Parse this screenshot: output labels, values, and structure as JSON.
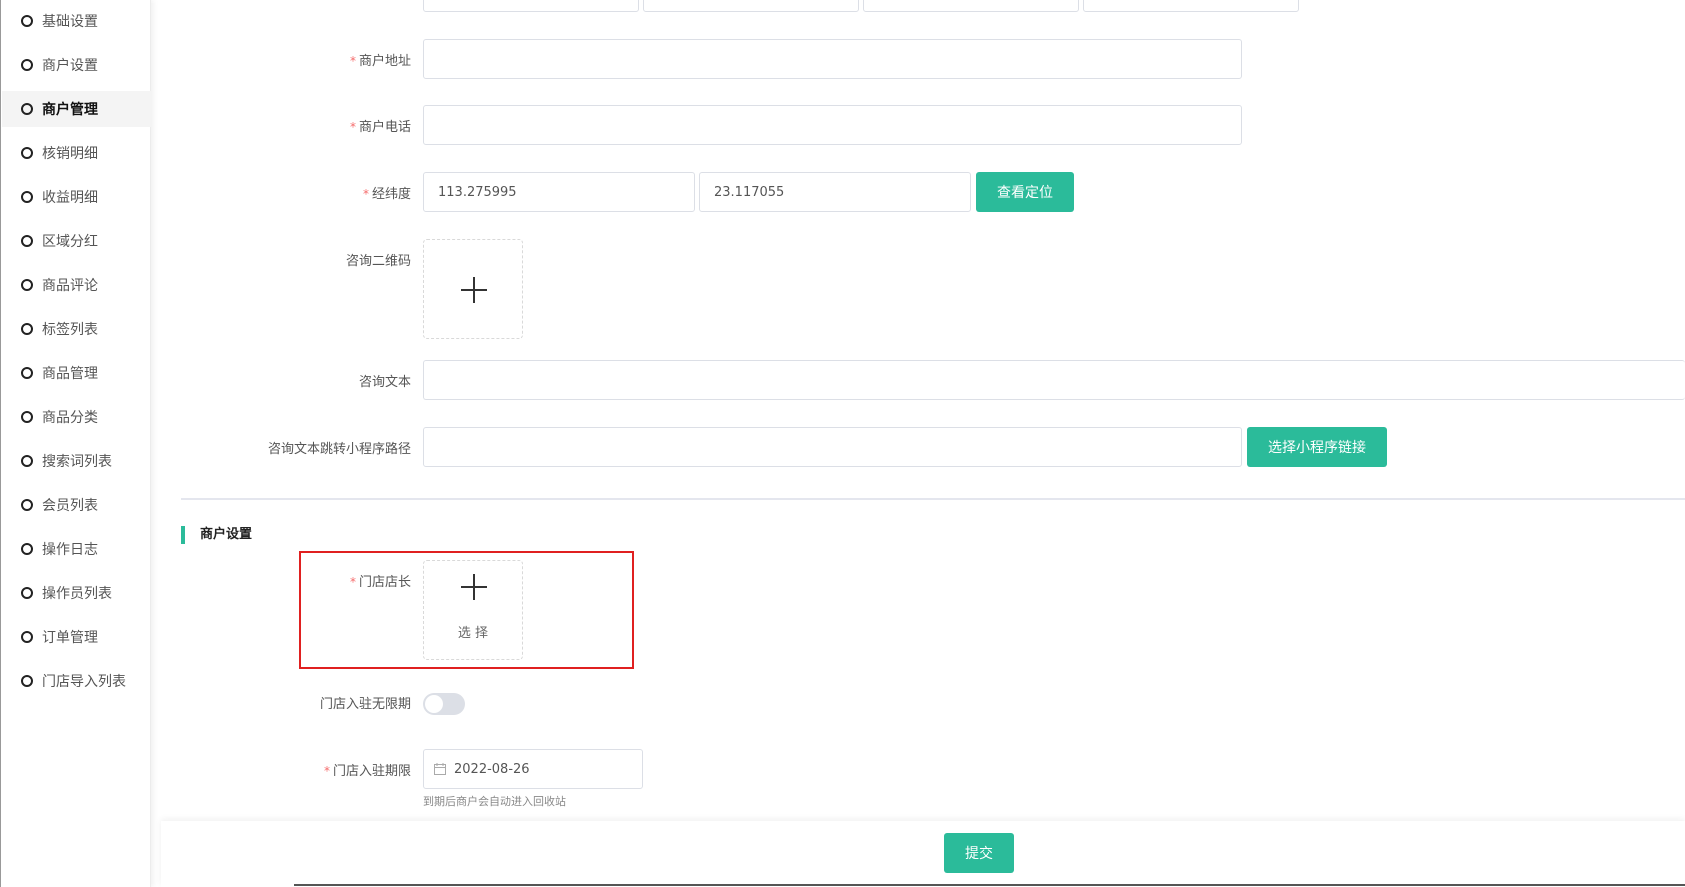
{
  "sidebar": {
    "items": [
      {
        "label": "基础设置",
        "active": false
      },
      {
        "label": "商户设置",
        "active": false
      },
      {
        "label": "商户管理",
        "active": true
      },
      {
        "label": "核销明细",
        "active": false
      },
      {
        "label": "收益明细",
        "active": false
      },
      {
        "label": "区域分红",
        "active": false
      },
      {
        "label": "商品评论",
        "active": false
      },
      {
        "label": "标签列表",
        "active": false
      },
      {
        "label": "商品管理",
        "active": false
      },
      {
        "label": "商品分类",
        "active": false
      },
      {
        "label": "搜索词列表",
        "active": false
      },
      {
        "label": "会员列表",
        "active": false
      },
      {
        "label": "操作日志",
        "active": false
      },
      {
        "label": "操作员列表",
        "active": false
      },
      {
        "label": "订单管理",
        "active": false
      },
      {
        "label": "门店导入列表",
        "active": false
      }
    ]
  },
  "form": {
    "address": {
      "label": "商户地址",
      "required": "*",
      "value": ""
    },
    "phone": {
      "label": "商户电话",
      "required": "*",
      "value": ""
    },
    "lnglat": {
      "label": "经纬度",
      "required": "*",
      "lng": "113.275995",
      "lat": "23.117055",
      "button": "查看定位"
    },
    "qrcode": {
      "label": "咨询二维码"
    },
    "consult_text": {
      "label": "咨询文本",
      "value": ""
    },
    "consult_path": {
      "label": "咨询文本跳转小程序路径",
      "value": "",
      "button": "选择小程序链接"
    }
  },
  "merchant_section": {
    "title": "商户设置",
    "manager": {
      "label": "门店店长",
      "required": "*",
      "select_text": "选 择"
    },
    "unlimited": {
      "label": "门店入驻无限期",
      "enabled": false
    },
    "expiry": {
      "label": "门店入驻期限",
      "required": "*",
      "value": "2022-08-26",
      "hint": "到期后商户会自动进入回收站"
    }
  },
  "footer": {
    "submit": "提交"
  },
  "colors": {
    "primary": "#2bbb9a",
    "required": "#f56c6c",
    "highlight": "#e02020"
  },
  "icons": {
    "plus": "plus-icon",
    "calendar": "calendar-icon",
    "menu_bullet": "circle-icon"
  }
}
